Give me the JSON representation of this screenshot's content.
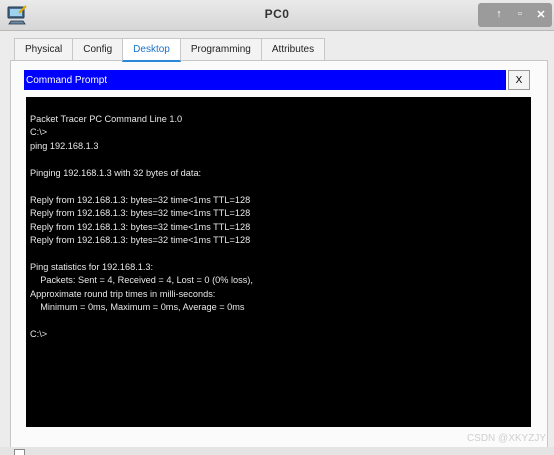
{
  "window": {
    "title": "PC0",
    "app_icon": "packet-tracer-pc-icon",
    "controls": {
      "maximize_glyph": "↑",
      "restore_glyph": "▫",
      "close_glyph": "✕"
    }
  },
  "tabs": [
    {
      "label": "Physical",
      "active": false
    },
    {
      "label": "Config",
      "active": false
    },
    {
      "label": "Desktop",
      "active": true
    },
    {
      "label": "Programming",
      "active": false
    },
    {
      "label": "Attributes",
      "active": false
    }
  ],
  "command_prompt": {
    "title": "Command Prompt",
    "close_label": "X",
    "header_color": "#0000ff",
    "lines": [
      "Packet Tracer PC Command Line 1.0",
      "C:\\>",
      "ping 192.168.1.3",
      "",
      "Pinging 192.168.1.3 with 32 bytes of data:",
      "",
      "Reply from 192.168.1.3: bytes=32 time<1ms TTL=128",
      "Reply from 192.168.1.3: bytes=32 time<1ms TTL=128",
      "Reply from 192.168.1.3: bytes=32 time<1ms TTL=128",
      "Reply from 192.168.1.3: bytes=32 time<1ms TTL=128",
      "",
      "Ping statistics for 192.168.1.3:",
      "    Packets: Sent = 4, Received = 4, Lost = 0 (0% loss),",
      "Approximate round trip times in milli-seconds:",
      "    Minimum = 0ms, Maximum = 0ms, Average = 0ms",
      "",
      "C:\\>"
    ]
  },
  "watermark": "CSDN @XKYZJY"
}
